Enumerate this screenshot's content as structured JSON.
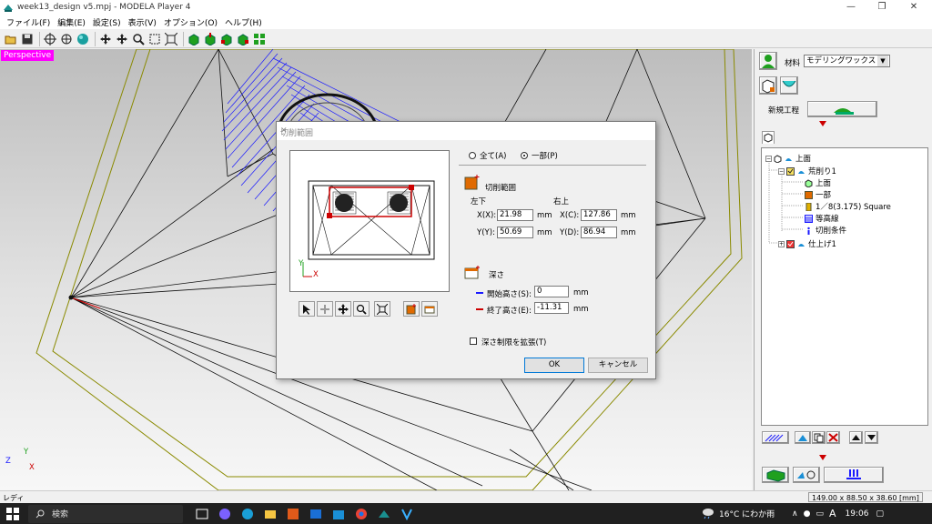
{
  "window": {
    "title": "week13_design v5.mpj - MODELA Player 4",
    "controls": [
      "—",
      "❐",
      "✕"
    ]
  },
  "menu": [
    "ファイル(F)",
    "編集(E)",
    "設定(S)",
    "表示(V)",
    "オプション(O)",
    "ヘルプ(H)"
  ],
  "toolbar": {
    "icons": [
      "open-folder-icon",
      "save-icon",
      "view-fit-icon",
      "view-rotate-icon",
      "sphere-render-icon",
      "move-icon",
      "pan-icon",
      "zoom-icon",
      "zoom-window-icon",
      "zoom-fit-icon",
      "green-box-icon",
      "green-box-down-icon",
      "green-box-front-icon",
      "green-box-side-icon",
      "grid-icon"
    ]
  },
  "viewport": {
    "label": "Perspective",
    "axis_x": "X",
    "axis_y": "Y",
    "axis_z": "Z"
  },
  "right_panel": {
    "material_label": "材料",
    "material_value": "モデリングワックス",
    "new_process_label": "新規工程",
    "tree": [
      {
        "label": "上面",
        "icon": "surface-icon"
      },
      {
        "label": "荒削り1",
        "icon": "roughing-icon"
      },
      {
        "label": "上面",
        "icon": "surface-icon"
      },
      {
        "label": "一部",
        "icon": "area-icon"
      },
      {
        "label": "1／8(3.175) Square",
        "icon": "tool-icon"
      },
      {
        "label": "等高線",
        "icon": "contour-icon"
      },
      {
        "label": "切削条件",
        "icon": "info-icon"
      },
      {
        "label": "仕上げ1",
        "icon": "finishing-icon"
      }
    ]
  },
  "dialog": {
    "title": "切削範囲",
    "radio_all": "全て(A)",
    "radio_part": "一部(P)",
    "cut_area_label": "切削範囲",
    "lower_left": "左下",
    "upper_right": "右上",
    "x_label": "X(X):",
    "y_label": "Y(Y):",
    "xc_label": "X(C):",
    "yd_label": "Y(D):",
    "x_value": "21.98",
    "y_value": "50.69",
    "xc_value": "127.86",
    "yd_value": "86.94",
    "unit": "mm",
    "depth_label": "深さ",
    "start_height_label": "開始高さ(S):",
    "end_height_label": "終了高さ(E):",
    "start_height_value": "0",
    "end_height_value": "-11.31",
    "extend_depth_label": "深さ制限を拡張(T)",
    "ok": "OK",
    "cancel": "キャンセル",
    "preview_axis_x": "X",
    "preview_axis_y": "Y"
  },
  "status": {
    "left": "レディ",
    "right": "149.00 x 88.50 x 38.60 [mm]"
  },
  "taskbar": {
    "search": "検索",
    "weather": "16°C  にわか雨",
    "ime": "A",
    "time": "19:06"
  },
  "colors": {
    "perspective_tag": "#ff00ff",
    "toolpath_blue": "#1a1aff",
    "stock_outline": "#8a8a00",
    "selection_red": "#cc0000"
  }
}
